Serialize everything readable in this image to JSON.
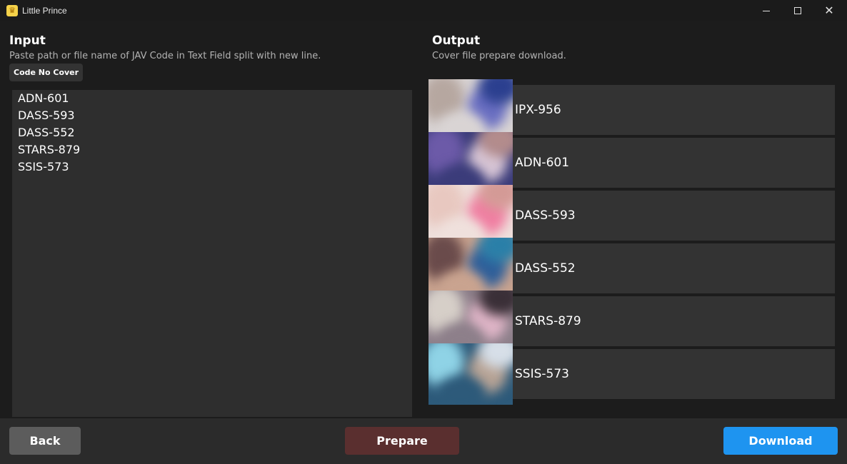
{
  "window": {
    "title": "Little Prince",
    "icon": "crown-icon",
    "controls": [
      "minimize-icon",
      "maximize-icon",
      "close-icon"
    ]
  },
  "input": {
    "title": "Input",
    "subtitle": "Paste path or file name of JAV Code in Text Field split with new line.",
    "badge": "Code No Cover",
    "lines": [
      "ADN-601",
      "DASS-593",
      "DASS-552",
      "STARS-879",
      "SSIS-573"
    ]
  },
  "output": {
    "title": "Output",
    "subtitle": "Cover file prepare download.",
    "items": [
      {
        "code": "IPX-956",
        "thumb_colors": [
          "#b6a7a0",
          "#6a6fc2",
          "#d9d4d4",
          "#2b3f8f"
        ]
      },
      {
        "code": "ADN-601",
        "thumb_colors": [
          "#6c5aa8",
          "#d8c6d6",
          "#3b3c7a",
          "#b38c8c"
        ]
      },
      {
        "code": "DASS-593",
        "thumb_colors": [
          "#e8c8c0",
          "#f07fa2",
          "#efe0dc",
          "#d49a96"
        ]
      },
      {
        "code": "DASS-552",
        "thumb_colors": [
          "#6a4b4b",
          "#2f5f9a",
          "#c9a38f",
          "#2a7fa8"
        ]
      },
      {
        "code": "STARS-879",
        "thumb_colors": [
          "#d6cfc8",
          "#e0b6c8",
          "#8d7f8a",
          "#3a2f37"
        ]
      },
      {
        "code": "SSIS-573",
        "thumb_colors": [
          "#8fd3e6",
          "#b8a496",
          "#2d5a7a",
          "#d7dfe8"
        ]
      }
    ]
  },
  "buttons": {
    "back": "Back",
    "prepare": "Prepare",
    "download": "Download"
  }
}
